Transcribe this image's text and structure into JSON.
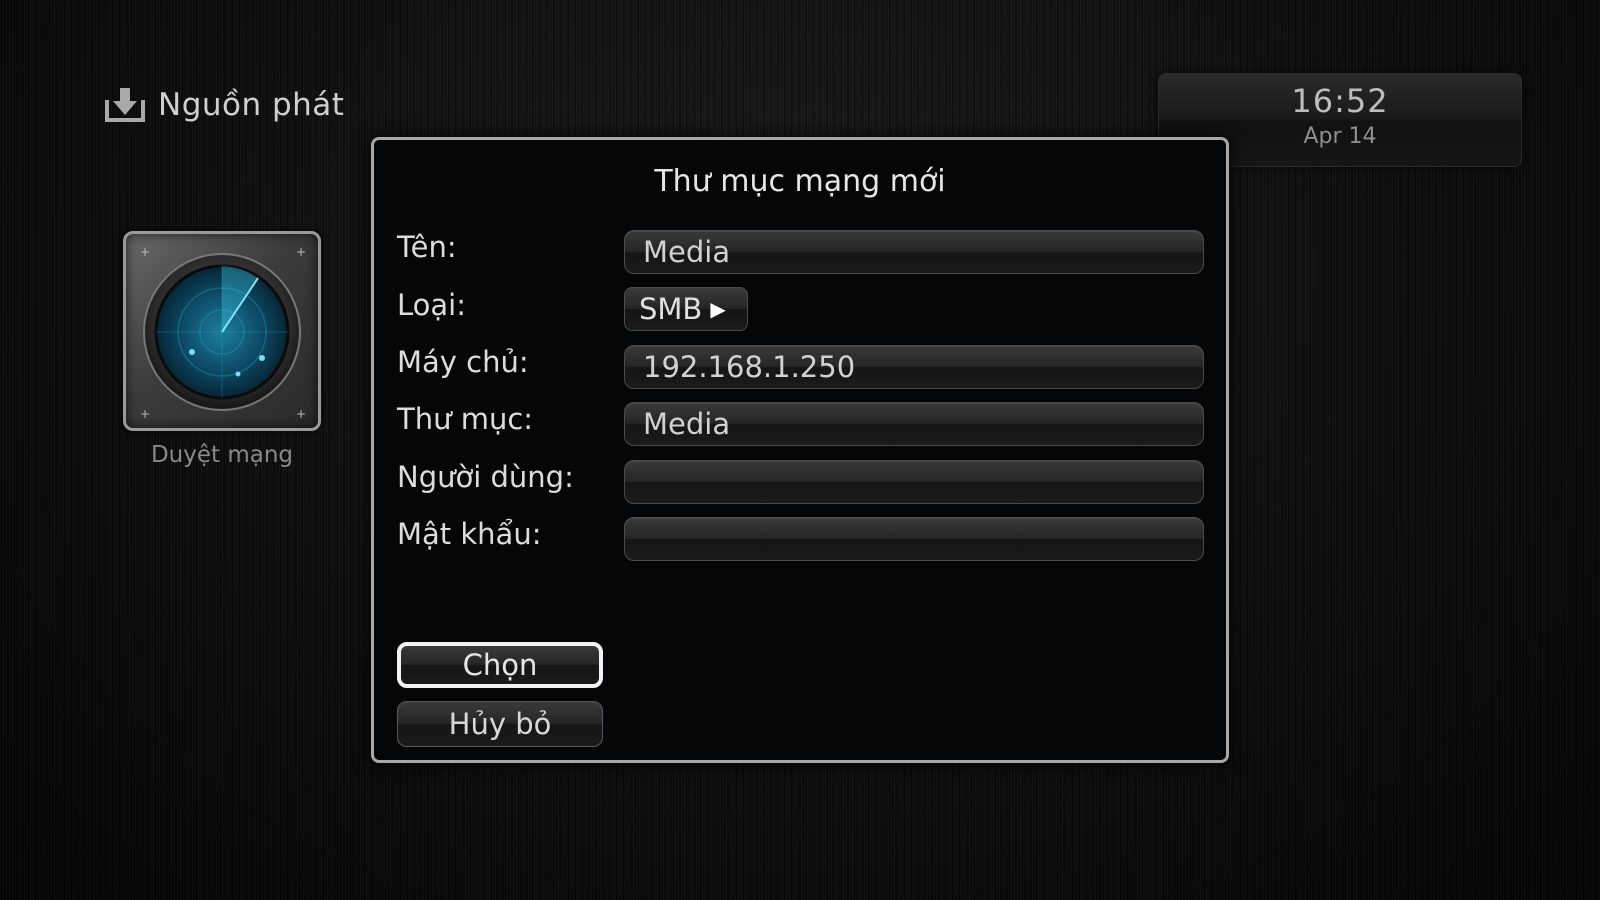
{
  "header": {
    "title": "Nguồn phát",
    "icon": "download-tray-icon"
  },
  "clock": {
    "time": "16:52",
    "date": "Apr 14"
  },
  "tile": {
    "icon": "radar-icon",
    "label": "Duyệt mạng"
  },
  "dialog": {
    "title": "Thư mục mạng mới",
    "fields": {
      "name": {
        "label": "Tên:",
        "value": "Media"
      },
      "type": {
        "label": "Loại:",
        "value": "SMB",
        "icon": "play-arrow-icon"
      },
      "server": {
        "label": "Máy chủ:",
        "value": "192.168.1.250"
      },
      "folder": {
        "label": "Thư mục:",
        "value": "Media"
      },
      "user": {
        "label": "Người dùng:",
        "value": ""
      },
      "password": {
        "label": "Mật khẩu:",
        "value": ""
      }
    },
    "buttons": {
      "select": "Chọn",
      "cancel": "Hủy bỏ"
    }
  },
  "colors": {
    "focus_border": "#f2f2f2",
    "dialog_border": "#a8a8a8",
    "radar_accent": "#1fa8c8"
  }
}
